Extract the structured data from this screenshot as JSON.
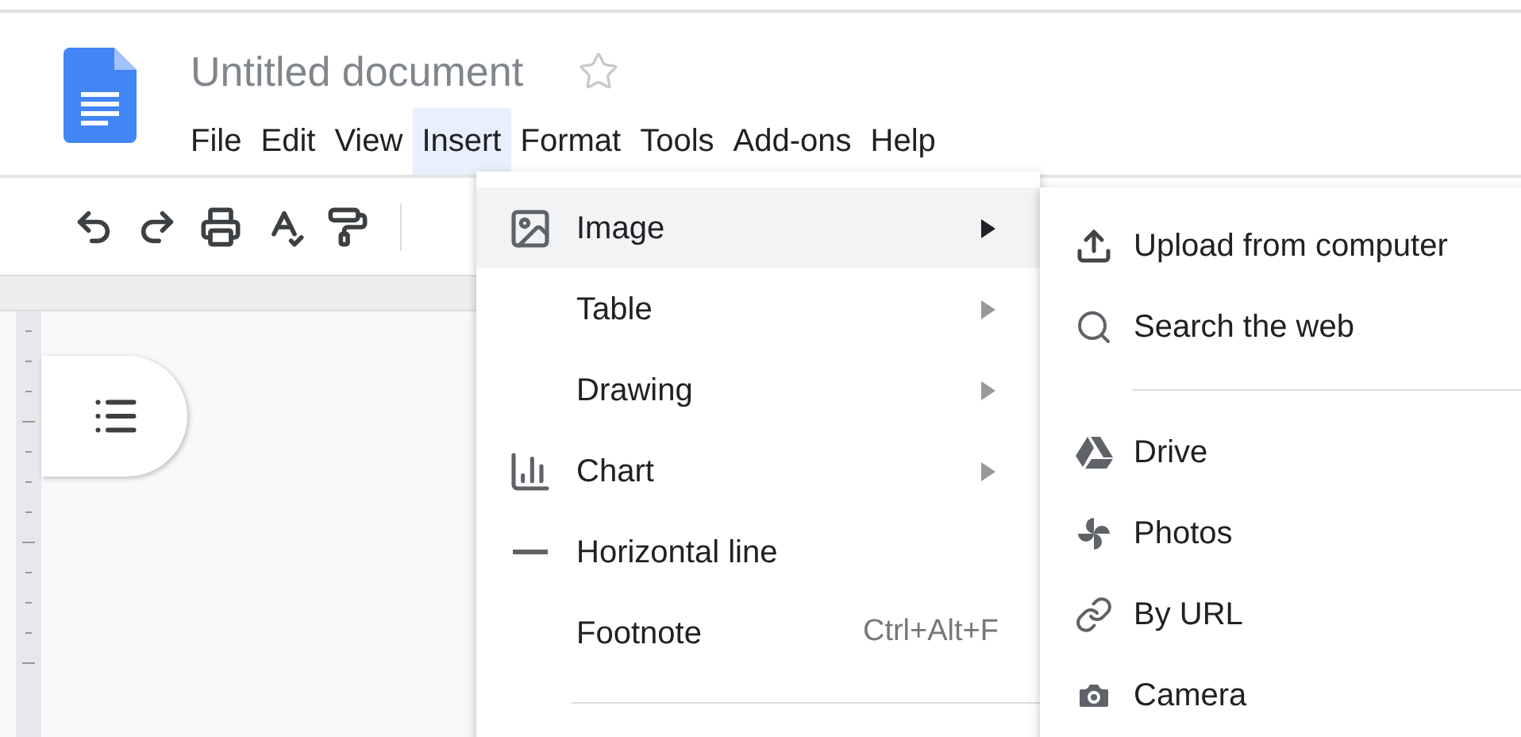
{
  "document": {
    "title": "Untitled document"
  },
  "menu_bar": [
    {
      "label": "File",
      "selected": false
    },
    {
      "label": "Edit",
      "selected": false
    },
    {
      "label": "View",
      "selected": false
    },
    {
      "label": "Insert",
      "selected": true
    },
    {
      "label": "Format",
      "selected": false
    },
    {
      "label": "Tools",
      "selected": false
    },
    {
      "label": "Add-ons",
      "selected": false
    },
    {
      "label": "Help",
      "selected": false
    }
  ],
  "insert_menu": {
    "items": [
      {
        "label": "Image",
        "selected": true,
        "submenu": true
      },
      {
        "label": "Table",
        "selected": false,
        "submenu": true
      },
      {
        "label": "Drawing",
        "selected": false,
        "submenu": true
      },
      {
        "label": "Chart",
        "selected": false,
        "submenu": true
      },
      {
        "label": "Horizontal line",
        "selected": false,
        "submenu": false
      },
      {
        "label": "Footnote",
        "selected": false,
        "submenu": false,
        "shortcut": "Ctrl+Alt+F"
      }
    ]
  },
  "image_submenu": {
    "groups": [
      [
        {
          "label": "Upload from computer"
        },
        {
          "label": "Search the web"
        }
      ],
      [
        {
          "label": "Drive"
        },
        {
          "label": "Photos"
        },
        {
          "label": "By URL"
        },
        {
          "label": "Camera"
        }
      ]
    ]
  }
}
